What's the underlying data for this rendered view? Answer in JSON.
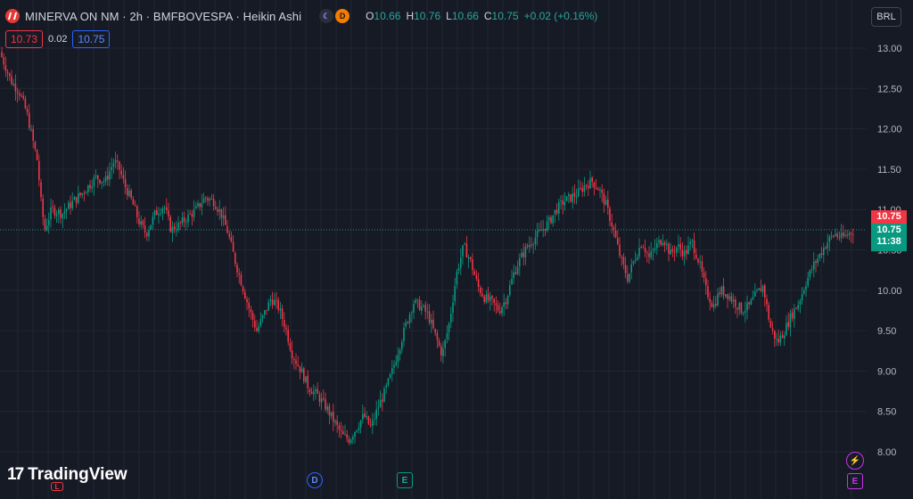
{
  "header": {
    "title": "MINERVA ON NM · 2h · BMFBOVESPA · Heikin Ashi",
    "badge_moon": "☾",
    "badge_div": "D",
    "ohlc": [
      {
        "key": "O",
        "value": "10.66"
      },
      {
        "key": "H",
        "value": "10.76"
      },
      {
        "key": "L",
        "value": "10.66"
      },
      {
        "key": "C",
        "value": "10.75"
      }
    ],
    "change": "+0.02 (+0.16%)"
  },
  "quote": {
    "bid": "10.73",
    "spread": "0.02",
    "ask": "10.75"
  },
  "currency": "BRL",
  "price_tags": {
    "red": "10.75",
    "green_price": "10.75",
    "green_timer": "11:38"
  },
  "brand": "TradingView",
  "events": {
    "d": "D",
    "e1": "E",
    "e2": "E",
    "l": "L",
    "flash": "⚡"
  },
  "colors": {
    "up": "#089981",
    "down": "#f23645",
    "bg": "#161a25",
    "grid": "#232632"
  },
  "chart_data": {
    "type": "candlestick",
    "ylim": [
      7.95,
      13.25
    ],
    "yticks": [
      "13.00",
      "12.50",
      "12.00",
      "11.50",
      "11.00",
      "10.50",
      "10.00",
      "9.50",
      "9.00",
      "8.50",
      "8.00"
    ],
    "last_price": 10.75,
    "close_path": [
      [
        0,
        12.95
      ],
      [
        12,
        12.6
      ],
      [
        22,
        12.45
      ],
      [
        30,
        12.2
      ],
      [
        36,
        11.9
      ],
      [
        42,
        11.6
      ],
      [
        46,
        11.1
      ],
      [
        50,
        10.75
      ],
      [
        58,
        11.0
      ],
      [
        70,
        10.95
      ],
      [
        82,
        11.1
      ],
      [
        92,
        11.2
      ],
      [
        100,
        11.3
      ],
      [
        108,
        11.4
      ],
      [
        118,
        11.35
      ],
      [
        128,
        11.6
      ],
      [
        134,
        11.5
      ],
      [
        140,
        11.3
      ],
      [
        148,
        11.1
      ],
      [
        156,
        10.85
      ],
      [
        164,
        10.7
      ],
      [
        174,
        10.95
      ],
      [
        184,
        11.05
      ],
      [
        192,
        10.75
      ],
      [
        200,
        10.8
      ],
      [
        210,
        10.9
      ],
      [
        220,
        11.0
      ],
      [
        230,
        11.15
      ],
      [
        240,
        11.1
      ],
      [
        248,
        10.95
      ],
      [
        256,
        10.7
      ],
      [
        264,
        10.35
      ],
      [
        272,
        10.05
      ],
      [
        280,
        9.75
      ],
      [
        288,
        9.5
      ],
      [
        296,
        9.7
      ],
      [
        304,
        9.9
      ],
      [
        312,
        9.8
      ],
      [
        320,
        9.55
      ],
      [
        328,
        9.2
      ],
      [
        338,
        9.0
      ],
      [
        346,
        8.8
      ],
      [
        356,
        8.7
      ],
      [
        366,
        8.55
      ],
      [
        376,
        8.35
      ],
      [
        384,
        8.2
      ],
      [
        392,
        8.15
      ],
      [
        400,
        8.3
      ],
      [
        408,
        8.45
      ],
      [
        416,
        8.3
      ],
      [
        424,
        8.55
      ],
      [
        432,
        8.75
      ],
      [
        440,
        9.0
      ],
      [
        448,
        9.3
      ],
      [
        456,
        9.6
      ],
      [
        464,
        9.85
      ],
      [
        472,
        9.8
      ],
      [
        480,
        9.7
      ],
      [
        488,
        9.45
      ],
      [
        496,
        9.2
      ],
      [
        504,
        9.6
      ],
      [
        512,
        10.2
      ],
      [
        520,
        10.55
      ],
      [
        528,
        10.35
      ],
      [
        536,
        10.05
      ],
      [
        544,
        9.9
      ],
      [
        552,
        9.85
      ],
      [
        560,
        9.75
      ],
      [
        568,
        9.9
      ],
      [
        576,
        10.2
      ],
      [
        584,
        10.4
      ],
      [
        592,
        10.55
      ],
      [
        600,
        10.65
      ],
      [
        608,
        10.75
      ],
      [
        616,
        10.85
      ],
      [
        624,
        11.0
      ],
      [
        632,
        11.1
      ],
      [
        640,
        11.15
      ],
      [
        648,
        11.2
      ],
      [
        656,
        11.3
      ],
      [
        664,
        11.35
      ],
      [
        672,
        11.25
      ],
      [
        680,
        11.05
      ],
      [
        688,
        10.75
      ],
      [
        696,
        10.4
      ],
      [
        704,
        10.15
      ],
      [
        712,
        10.4
      ],
      [
        720,
        10.6
      ],
      [
        728,
        10.4
      ],
      [
        736,
        10.55
      ],
      [
        744,
        10.65
      ],
      [
        752,
        10.45
      ],
      [
        760,
        10.55
      ],
      [
        768,
        10.45
      ],
      [
        776,
        10.6
      ],
      [
        784,
        10.35
      ],
      [
        792,
        10.0
      ],
      [
        800,
        9.8
      ],
      [
        808,
        10.0
      ],
      [
        816,
        9.95
      ],
      [
        824,
        9.85
      ],
      [
        832,
        9.75
      ],
      [
        840,
        9.8
      ],
      [
        848,
        9.95
      ],
      [
        856,
        10.05
      ],
      [
        864,
        9.55
      ],
      [
        872,
        9.35
      ],
      [
        880,
        9.5
      ],
      [
        888,
        9.7
      ],
      [
        896,
        9.85
      ],
      [
        904,
        10.1
      ],
      [
        912,
        10.3
      ],
      [
        920,
        10.45
      ],
      [
        928,
        10.6
      ],
      [
        936,
        10.7
      ],
      [
        944,
        10.65
      ],
      [
        952,
        10.7
      ],
      [
        958,
        10.75
      ]
    ]
  }
}
